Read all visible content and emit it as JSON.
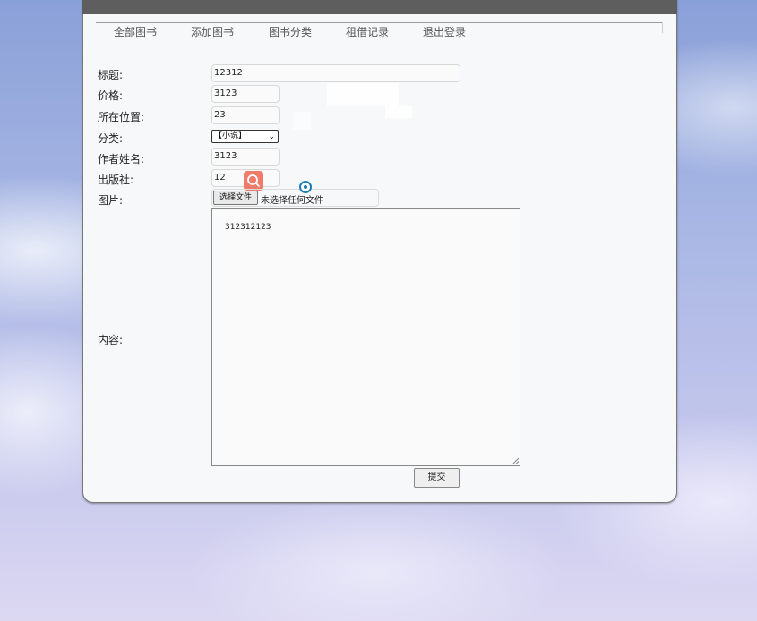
{
  "nav": {
    "items": [
      "全部图书",
      "添加图书",
      "图书分类",
      "租借记录",
      "退出登录"
    ]
  },
  "form": {
    "title_label": "标题:",
    "title_value": "12312",
    "price_label": "价格:",
    "price_value": "3123",
    "location_label": "所在位置:",
    "location_value": "23",
    "category_label": "分类:",
    "category_value": "【小说】",
    "author_label": "作者姓名:",
    "author_value": "3123",
    "publisher_label": "出版社:",
    "publisher_value": "12",
    "image_label": "图片:",
    "file_button": "选择文件",
    "file_status": "未选择任何文件",
    "content_label": "内容:",
    "content_value": "312312123",
    "submit_label": "提交"
  },
  "icons": {
    "search_badge": "search-icon",
    "cursor": "cursor-icon"
  },
  "colors": {
    "search_badge": "#f07b6a",
    "cursor": "#1b7db3"
  }
}
